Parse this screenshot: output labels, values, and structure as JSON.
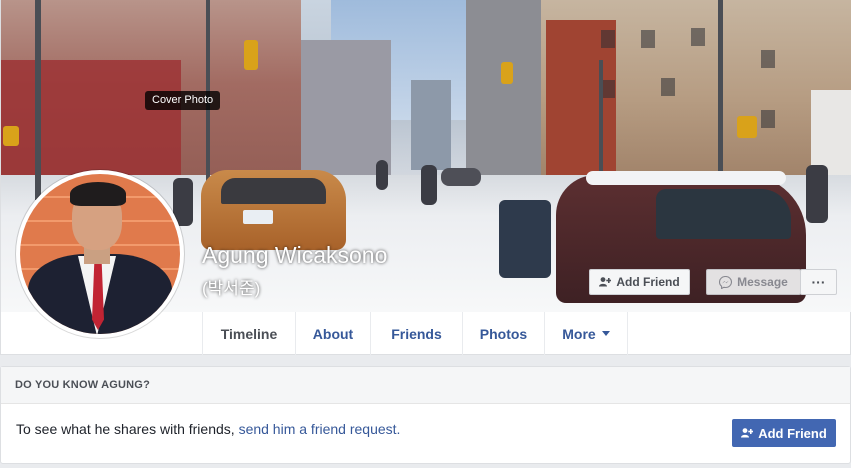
{
  "cover": {
    "tooltip": "Cover Photo",
    "name": "Agung Wicaksono",
    "alternate_name": "(박서준)",
    "add_friend_label": "Add Friend",
    "message_label": "Message",
    "more_label": "···",
    "icons": {
      "add_friend": "add-person-icon",
      "message": "messenger-icon",
      "more": "ellipsis-icon"
    }
  },
  "tabs": [
    {
      "label": "Timeline",
      "active": true
    },
    {
      "label": "About"
    },
    {
      "label": "Friends"
    },
    {
      "label": "Photos"
    },
    {
      "label": "More",
      "icon": "chevron-down-icon"
    }
  ],
  "know_box": {
    "heading": "DO YOU KNOW AGUNG?",
    "text": "To see what he shares with friends,",
    "link": "send him a friend request.",
    "button_label": "Add Friend"
  },
  "colors": {
    "link": "#365899",
    "primary_button": "#4267b2",
    "page_bg": "#e9ebee"
  }
}
